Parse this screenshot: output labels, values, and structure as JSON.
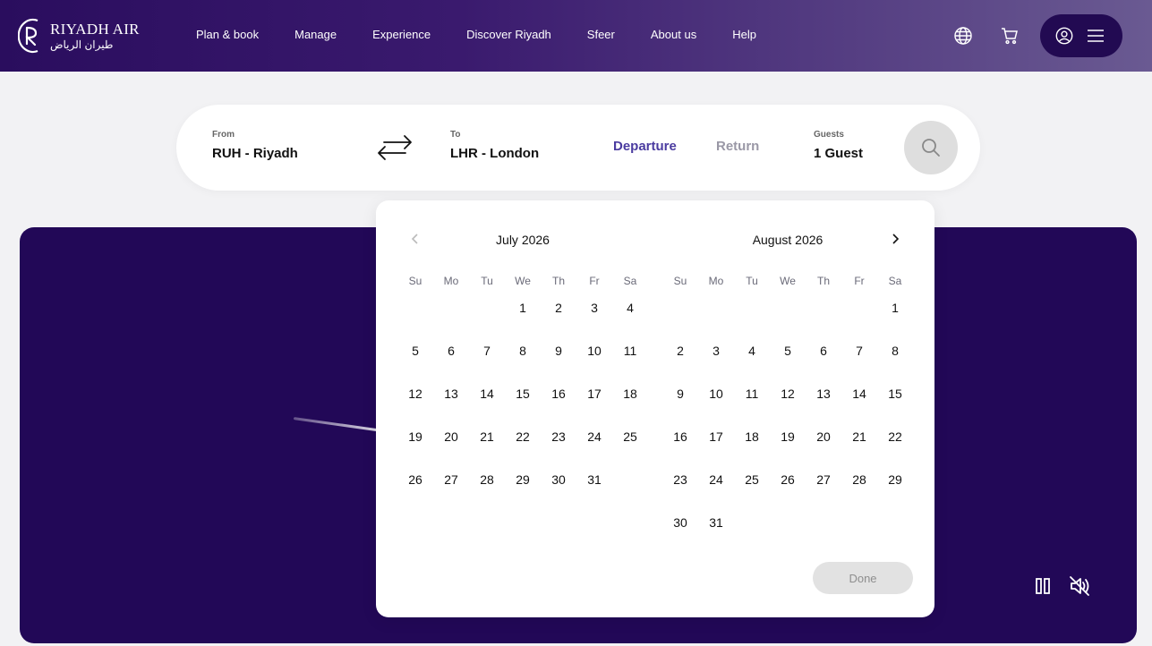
{
  "brand": {
    "name_en": "RIYADH AIR",
    "name_ar": "طيران الرياض"
  },
  "nav": {
    "items": [
      {
        "label": "Plan & book"
      },
      {
        "label": "Manage"
      },
      {
        "label": "Experience"
      },
      {
        "label": "Discover Riyadh"
      },
      {
        "label": "Sfeer"
      },
      {
        "label": "About us"
      },
      {
        "label": "Help"
      }
    ]
  },
  "header_icons": [
    "globe-icon",
    "cart-icon",
    "user-icon",
    "menu-icon"
  ],
  "search": {
    "from_label": "From",
    "from_value": "RUH - Riyadh",
    "to_label": "To",
    "to_value": "LHR - London",
    "departure_tab": "Departure",
    "return_tab": "Return",
    "guests_label": "Guests",
    "guests_value": "1 Guest"
  },
  "calendar": {
    "weekdays": [
      "Su",
      "Mo",
      "Tu",
      "We",
      "Th",
      "Fr",
      "Sa"
    ],
    "months": [
      {
        "title": "July 2026",
        "first_weekday": 3,
        "num_days": 31
      },
      {
        "title": "August 2026",
        "first_weekday": 6,
        "num_days": 31
      }
    ],
    "done_label": "Done"
  },
  "colors": {
    "brand_dark": "#220857",
    "accent": "#4b3ca0",
    "inactive": "#9a98a6"
  }
}
